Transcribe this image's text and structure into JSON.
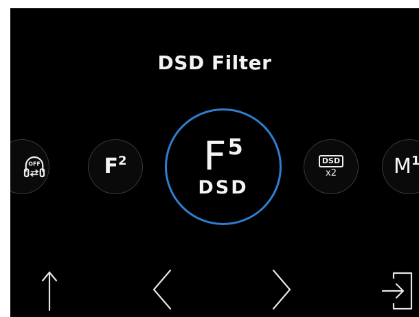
{
  "title": "DSD Filter",
  "accent_color": "#2e7fd0",
  "filters": {
    "left_partial": {
      "badge": "OFF",
      "icon": "headphone-crossfeed-off-icon"
    },
    "prev": {
      "letter": "F",
      "sup": "2"
    },
    "selected": {
      "letter": "F",
      "sup": "5",
      "sub": "DSD"
    },
    "next": {
      "badge": "DSD",
      "multiplier": "x2",
      "icon": "dsd-upsample-icon"
    },
    "right_partial": {
      "letter": "M",
      "sup": "1"
    }
  },
  "nav": {
    "up_icon": "arrow-up-icon",
    "prev_icon": "chevron-left-icon",
    "next_icon": "chevron-right-icon",
    "enter_icon": "enter-icon"
  }
}
